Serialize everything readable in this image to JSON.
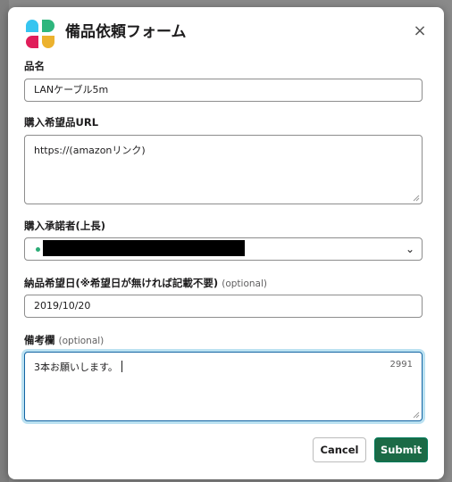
{
  "modal": {
    "title": "備品依頼フォーム",
    "close_label": "×"
  },
  "fields": {
    "item_name": {
      "label": "品名",
      "value": "LANケーブル5m"
    },
    "purchase_url": {
      "label": "購入希望品URL",
      "value": "https://(amazonリンク)"
    },
    "approver": {
      "label": "購入承諾者(上長)",
      "value_redacted": true
    },
    "desired_date": {
      "label": "納品希望日(※希望日が無ければ記載不要)",
      "optional": "(optional)",
      "value": "2019/10/20"
    },
    "remarks": {
      "label": "備考欄",
      "optional": "(optional)",
      "value": "3本お願いします。",
      "char_remaining": "2991"
    }
  },
  "buttons": {
    "cancel": "Cancel",
    "submit": "Submit"
  },
  "colors": {
    "submit_bg": "#1b6a46",
    "focus_border": "#1264a3",
    "status_dot": "#2bac76"
  }
}
